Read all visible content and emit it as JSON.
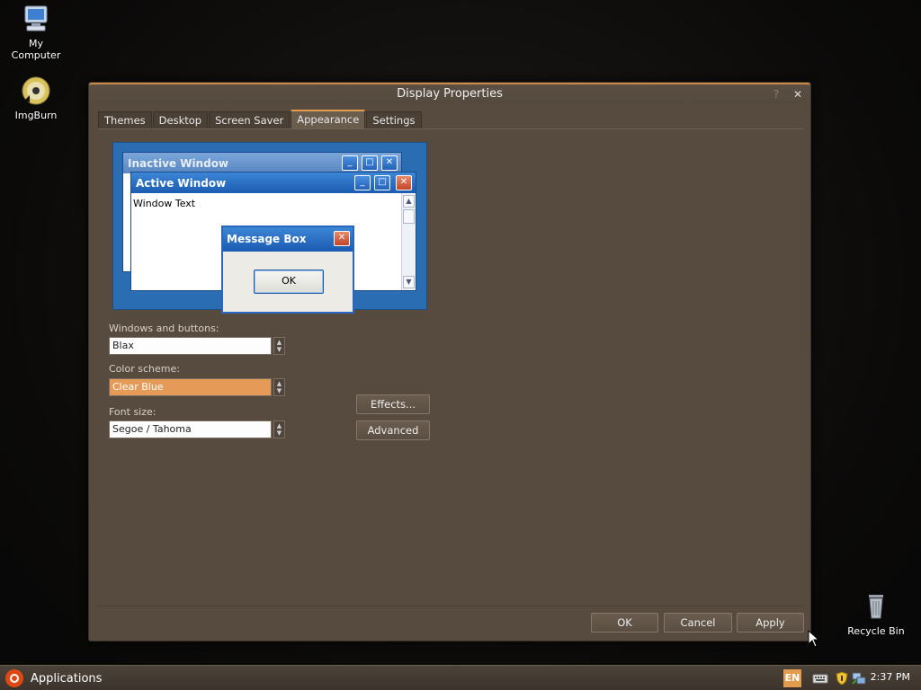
{
  "desktop": {
    "icons": [
      {
        "label_line1": "My",
        "label_line2": "Computer",
        "icon": "computer-icon"
      },
      {
        "label_line1": "ImgBurn",
        "icon": "disc-icon"
      },
      {
        "label_line1": "Recycle Bin",
        "icon": "trash-icon"
      }
    ]
  },
  "window": {
    "title": "Display Properties",
    "help_glyph": "?",
    "close_glyph": "✕",
    "tabs": [
      {
        "label": "Themes",
        "active": false
      },
      {
        "label": "Desktop",
        "active": false
      },
      {
        "label": "Screen Saver",
        "active": false
      },
      {
        "label": "Appearance",
        "active": true
      },
      {
        "label": "Settings",
        "active": false
      }
    ],
    "preview": {
      "inactive_title": "Inactive Window",
      "active_title": "Active Window",
      "window_text": "Window Text",
      "message_title": "Message Box",
      "message_ok": "OK"
    },
    "windows_buttons_label": "Windows and buttons:",
    "windows_buttons_value": "Blax",
    "color_scheme_label": "Color scheme:",
    "color_scheme_value": "Clear Blue",
    "font_size_label": "Font size:",
    "font_size_value": "Segoe / Tahoma",
    "effects_label": "Effects...",
    "advanced_label": "Advanced",
    "ok_label": "OK",
    "cancel_label": "Cancel",
    "apply_label": "Apply"
  },
  "taskbar": {
    "applications_label": "Applications",
    "lang": "EN",
    "clock": "2:37 PM"
  },
  "colors": {
    "accent": "#e39b4e",
    "window_bg": "#574b3f",
    "preview_blue": "#2b6db2"
  }
}
